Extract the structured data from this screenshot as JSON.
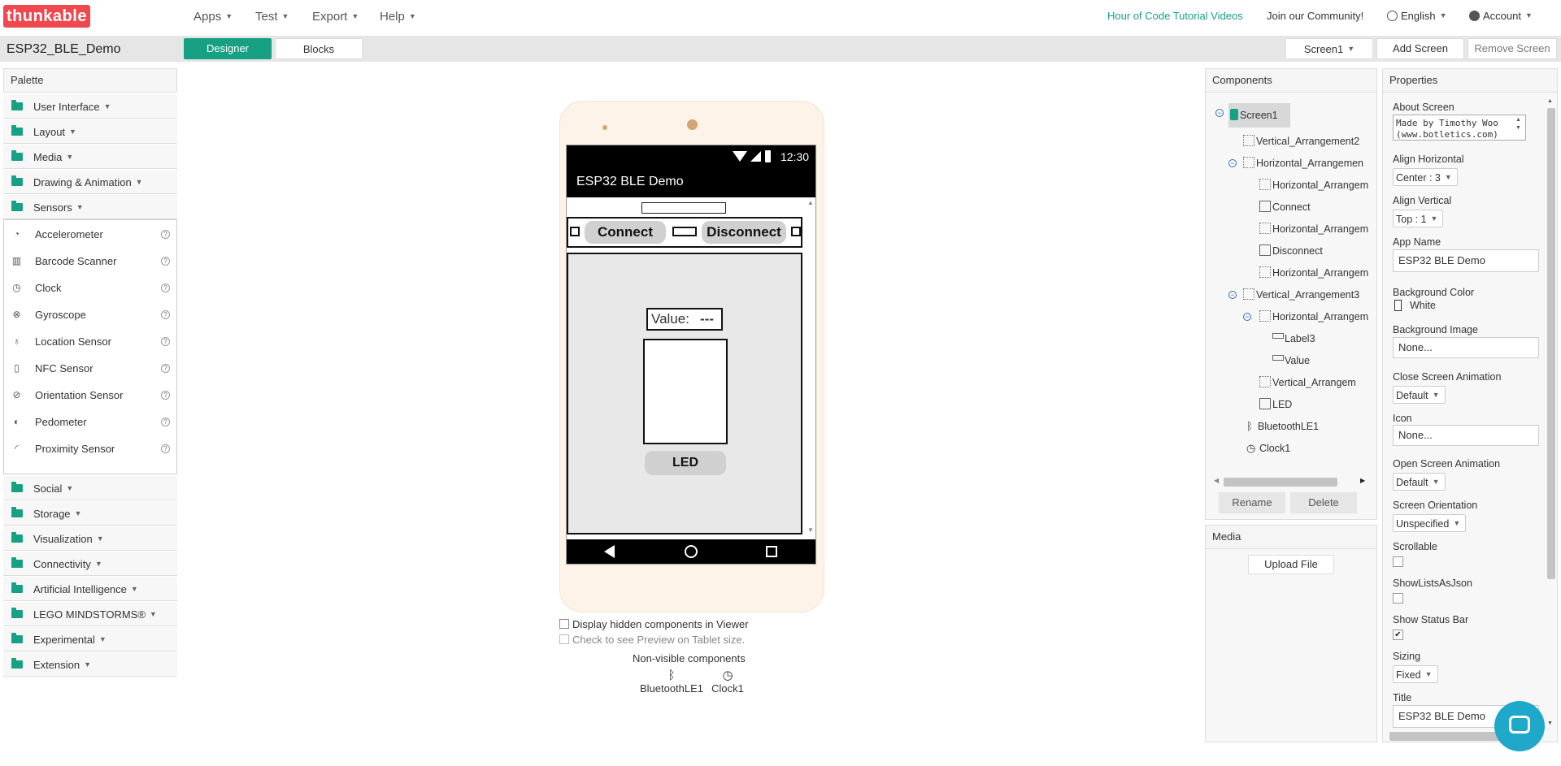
{
  "nav": {
    "logo": "thunkable",
    "menus": [
      {
        "label": "Apps"
      },
      {
        "label": "Test"
      },
      {
        "label": "Export"
      },
      {
        "label": "Help"
      }
    ],
    "hour_of_code": "Hour of Code Tutorial Videos",
    "community": "Join our Community!",
    "language": "English",
    "account": "Account",
    "accent_color": "#17a084",
    "logo_color": "#f0484f"
  },
  "project": {
    "name": "ESP32_BLE_Demo",
    "designer_label": "Designer",
    "blocks_label": "Blocks",
    "screen_selector": "Screen1",
    "add_screen": "Add Screen",
    "remove_screen": "Remove Screen"
  },
  "palette": {
    "title": "Palette",
    "categories_top": [
      {
        "label": "User Interface"
      },
      {
        "label": "Layout"
      },
      {
        "label": "Media"
      },
      {
        "label": "Drawing & Animation"
      },
      {
        "label": "Sensors"
      }
    ],
    "sensors": [
      {
        "label": "Accelerometer",
        "icon": "gauge-icon"
      },
      {
        "label": "Barcode Scanner",
        "icon": "barcode-icon"
      },
      {
        "label": "Clock",
        "icon": "clock-icon"
      },
      {
        "label": "Gyroscope",
        "icon": "gyroscope-icon"
      },
      {
        "label": "Location Sensor",
        "icon": "location-icon"
      },
      {
        "label": "NFC Sensor",
        "icon": "nfc-icon"
      },
      {
        "label": "Orientation Sensor",
        "icon": "orientation-icon"
      },
      {
        "label": "Pedometer",
        "icon": "footprint-icon"
      },
      {
        "label": "Proximity Sensor",
        "icon": "proximity-icon"
      }
    ],
    "categories_bottom": [
      {
        "label": "Social"
      },
      {
        "label": "Storage"
      },
      {
        "label": "Visualization"
      },
      {
        "label": "Connectivity"
      },
      {
        "label": "Artificial Intelligence"
      },
      {
        "label": "LEGO MINDSTORMS®"
      },
      {
        "label": "Experimental"
      },
      {
        "label": "Extension"
      }
    ]
  },
  "viewer": {
    "status_time": "12:30",
    "app_title": "ESP32 BLE Demo",
    "connect": "Connect",
    "disconnect": "Disconnect",
    "value_label": "Value:",
    "value_text": "---",
    "led_button": "LED",
    "display_hidden": "Display hidden components in Viewer",
    "tablet_preview": "Check to see Preview on Tablet size.",
    "nonvisible_title": "Non-visible components",
    "nonvisible": [
      {
        "label": "BluetoothLE1",
        "icon": "bluetooth-icon"
      },
      {
        "label": "Clock1",
        "icon": "clock-icon"
      }
    ]
  },
  "components": {
    "title": "Components",
    "tree": [
      {
        "label": "Screen1",
        "level": 0,
        "icon": "screen-icon"
      },
      {
        "label": "Vertical_Arrangement2",
        "level": 1,
        "icon": "vertical-arrangement-icon"
      },
      {
        "label": "Horizontal_Arrangemen",
        "level": 1,
        "icon": "horizontal-arrangement-icon"
      },
      {
        "label": "Horizontal_Arrangem",
        "level": 2,
        "icon": "horizontal-arrangement-icon"
      },
      {
        "label": "Connect",
        "level": 2,
        "icon": "button-icon"
      },
      {
        "label": "Horizontal_Arrangem",
        "level": 2,
        "icon": "horizontal-arrangement-icon"
      },
      {
        "label": "Disconnect",
        "level": 2,
        "icon": "button-icon"
      },
      {
        "label": "Horizontal_Arrangem",
        "level": 2,
        "icon": "horizontal-arrangement-icon"
      },
      {
        "label": "Vertical_Arrangement3",
        "level": 1,
        "icon": "vertical-arrangement-icon"
      },
      {
        "label": "Horizontal_Arrangem",
        "level": 2,
        "icon": "horizontal-arrangement-icon"
      },
      {
        "label": "Label3",
        "level": 3,
        "icon": "label-icon"
      },
      {
        "label": "Value",
        "level": 3,
        "icon": "label-icon"
      },
      {
        "label": "Vertical_Arrangem",
        "level": 2,
        "icon": "vertical-arrangement-icon"
      },
      {
        "label": "LED",
        "level": 2,
        "icon": "button-icon"
      },
      {
        "label": "BluetoothLE1",
        "level": 1,
        "icon": "bluetooth-icon"
      },
      {
        "label": "Clock1",
        "level": 1,
        "icon": "clock-icon"
      }
    ],
    "rename": "Rename",
    "delete": "Delete",
    "media_title": "Media",
    "upload": "Upload File"
  },
  "properties": {
    "title": "Properties",
    "about_screen_label": "About Screen",
    "about_screen_value": "Made by Timothy Woo (www.botletics.com)",
    "align_horizontal_label": "Align Horizontal",
    "align_horizontal_value": "Center : 3",
    "align_vertical_label": "Align Vertical",
    "align_vertical_value": "Top : 1",
    "app_name_label": "App Name",
    "app_name_value": "ESP32 BLE Demo",
    "bg_color_label": "Background Color",
    "bg_color_value": "White",
    "bg_image_label": "Background Image",
    "bg_image_value": "None...",
    "close_anim_label": "Close Screen Animation",
    "close_anim_value": "Default",
    "icon_label": "Icon",
    "icon_value": "None...",
    "open_anim_label": "Open Screen Animation",
    "open_anim_value": "Default",
    "orientation_label": "Screen Orientation",
    "orientation_value": "Unspecified",
    "scrollable_label": "Scrollable",
    "scrollable_checked": false,
    "showlists_label": "ShowListsAsJson",
    "showlists_checked": false,
    "statusbar_label": "Show Status Bar",
    "statusbar_checked": true,
    "sizing_label": "Sizing",
    "sizing_value": "Fixed",
    "title_label": "Title",
    "title_value": "ESP32 BLE Demo"
  }
}
